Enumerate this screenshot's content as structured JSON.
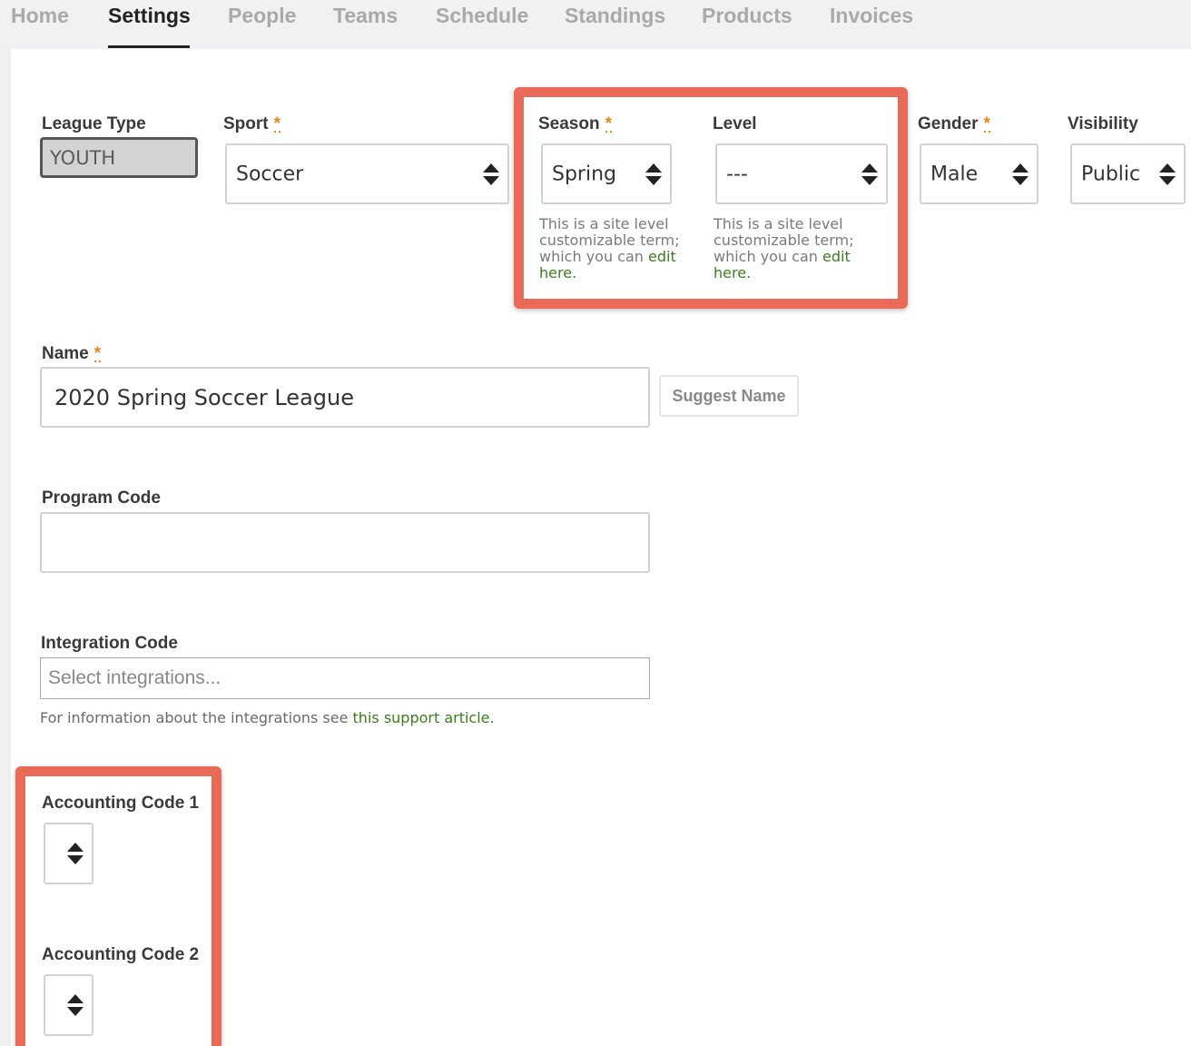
{
  "nav": {
    "tabs": [
      {
        "label": "Home",
        "active": false
      },
      {
        "label": "Settings",
        "active": true
      },
      {
        "label": "People",
        "active": false
      },
      {
        "label": "Teams",
        "active": false
      },
      {
        "label": "Schedule",
        "active": false
      },
      {
        "label": "Standings",
        "active": false
      },
      {
        "label": "Products",
        "active": false
      },
      {
        "label": "Invoices",
        "active": false
      }
    ]
  },
  "form": {
    "required_marker": "*",
    "league_type": {
      "label": "League Type",
      "value": "YOUTH"
    },
    "sport": {
      "label": "Sport",
      "value": "Soccer"
    },
    "season": {
      "label": "Season",
      "value": "Spring",
      "help": "This is a site level customizable term; which you can ",
      "help_link": "edit here",
      "help_end": "."
    },
    "level": {
      "label": "Level",
      "value": "---",
      "help": "This is a site level customizable term; which you can ",
      "help_link": "edit here",
      "help_end": "."
    },
    "gender": {
      "label": "Gender",
      "value": "Male"
    },
    "visibility": {
      "label": "Visibility",
      "value": "Public"
    },
    "name": {
      "label": "Name",
      "value": "2020 Spring Soccer League",
      "suggest_button": "Suggest Name"
    },
    "program_code": {
      "label": "Program Code",
      "value": ""
    },
    "integration_code": {
      "label": "Integration Code",
      "placeholder": "Select integrations...",
      "info": "For information about the integrations see ",
      "info_link": "this support article",
      "info_end": "."
    },
    "accounting_code_1": {
      "label": "Accounting Code 1",
      "value": ""
    },
    "accounting_code_2": {
      "label": "Accounting Code 2",
      "value": ""
    }
  },
  "colors": {
    "highlight": "#ea6a58",
    "link": "#3a7d1a",
    "required": "#e08a1e"
  }
}
